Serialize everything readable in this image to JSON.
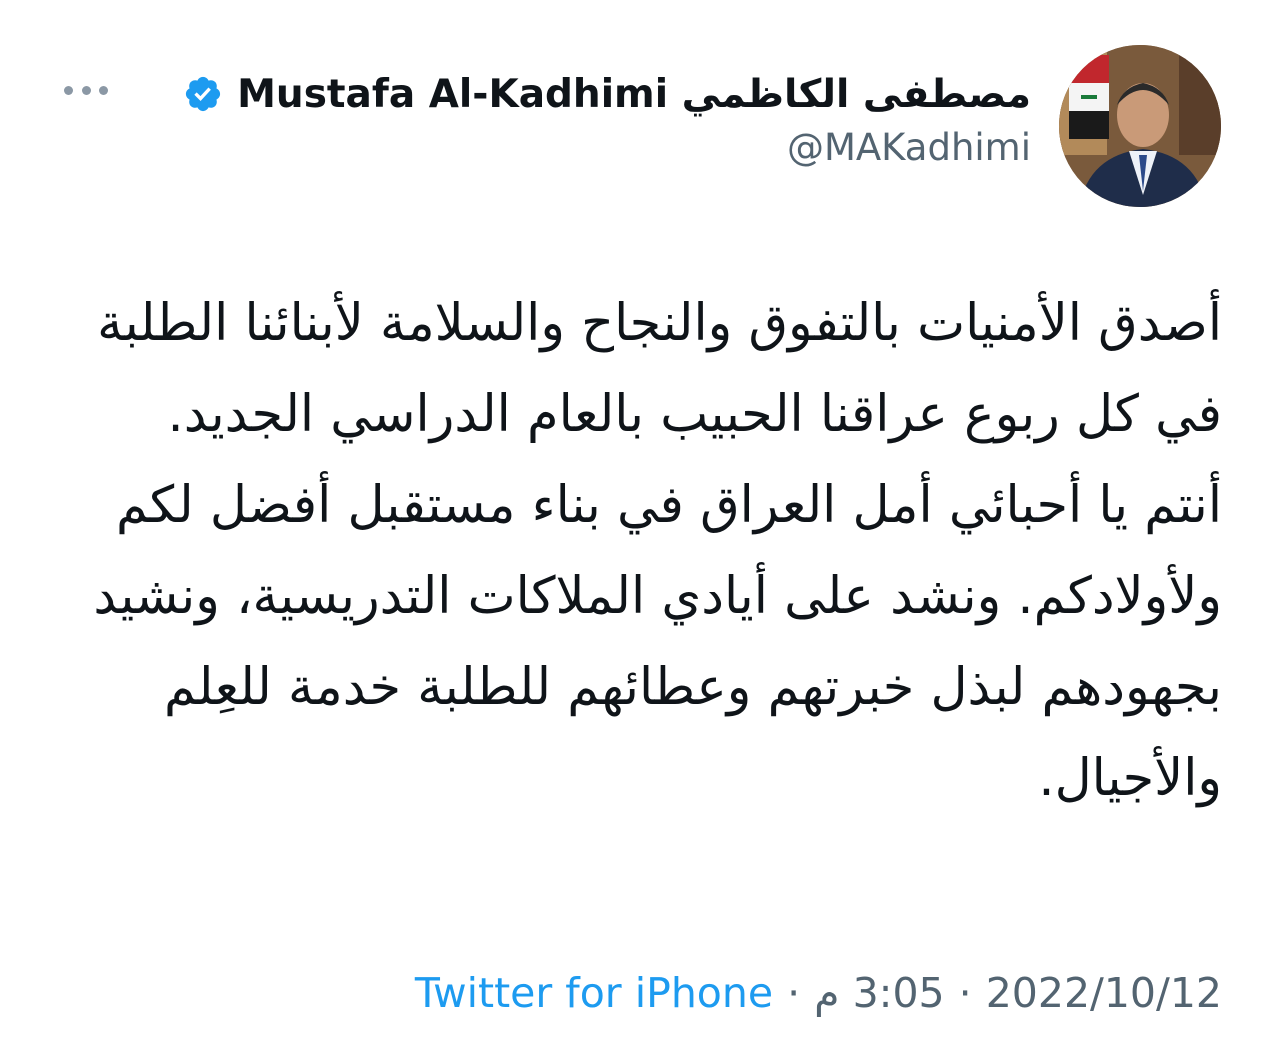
{
  "tweet": {
    "author": {
      "display_name": "مصطفى الكاظمي Mustafa Al-Kadhimi",
      "handle": "@MAKadhimi",
      "verified": true,
      "avatar_icon": "profile-photo"
    },
    "more_icon": "ellipsis-icon",
    "paragraphs": [
      "أصدق الأمنيات بالتفوق والنجاح والسلامة لأبنائنا الطلبة في كل ربوع عراقنا الحبيب بالعام الدراسي الجديد.",
      "أنتم يا أحبائي أمل العراق في بناء مستقبل أفضل لكم ولأولادكم. ونشد على أيادي الملاكات التدريسية، ونشيد بجهودهم لبذل خبرتهم وعطائهم للطلبة خدمة للعِلم والأجيال."
    ],
    "meta": {
      "date": "2022/10/12",
      "time": "3:05 م",
      "source": "Twitter for iPhone",
      "separator": "·"
    }
  },
  "colors": {
    "text": "#0f1419",
    "secondary": "#536471",
    "accent": "#1d9bf0"
  }
}
